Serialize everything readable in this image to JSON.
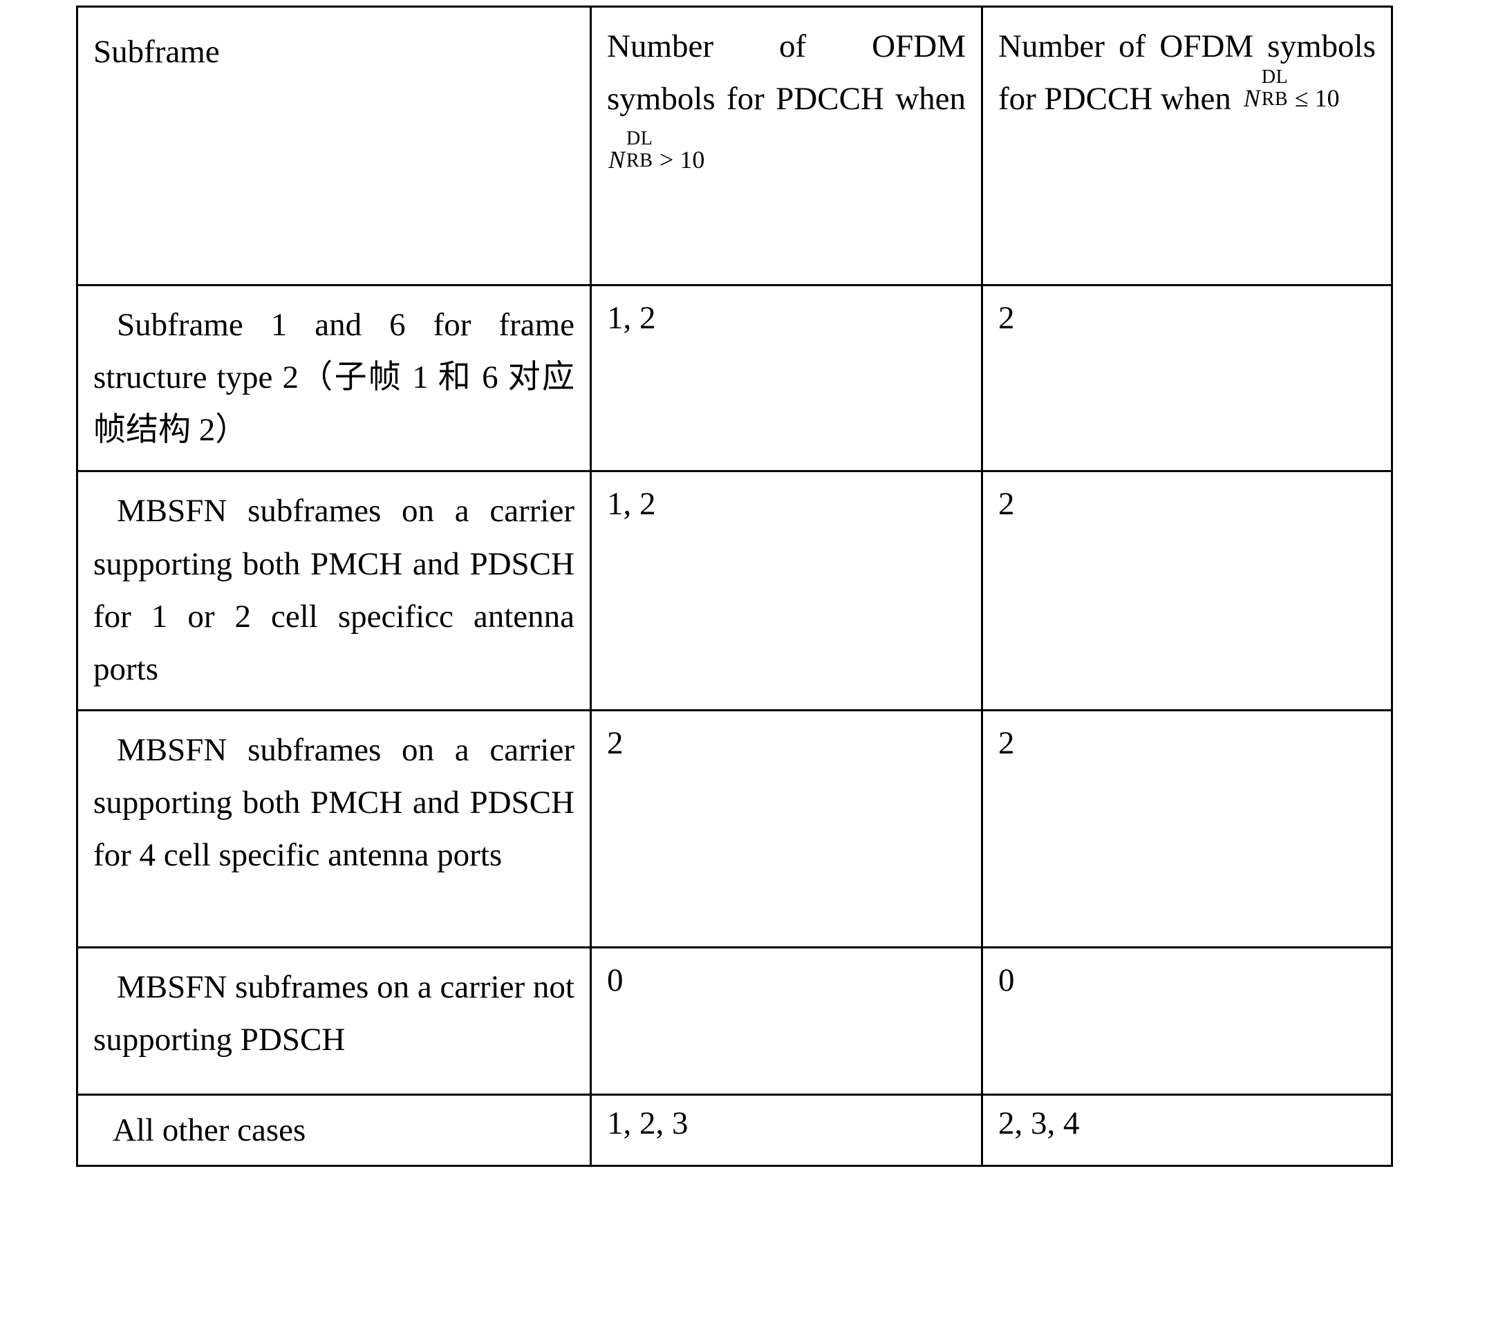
{
  "table": {
    "caption_visible": false,
    "columns": [
      {
        "key": "subframe",
        "header": "Subframe"
      },
      {
        "key": "gt10",
        "header_prefix": "Number of OFDM symbols for PDCCH when",
        "math": {
          "var": "N",
          "sup": "DL",
          "sub": "RB",
          "relation": "> 10"
        }
      },
      {
        "key": "le10",
        "header_prefix": "Number of OFDM symbols for PDCCH when",
        "math": {
          "var": "N",
          "sup": "DL",
          "sub": "RB",
          "relation": "≤ 10"
        }
      }
    ],
    "rows": [
      {
        "subframe": "Subframe 1 and 6 for frame structure type 2（子帧 1 和 6 对应帧结构 2）",
        "gt10": "1, 2",
        "le10": "2"
      },
      {
        "subframe": "MBSFN subframes on a carrier supporting both PMCH and PDSCH for 1 or 2 cell specificc antenna ports",
        "gt10": "1, 2",
        "le10": "2"
      },
      {
        "subframe": "MBSFN subframes on a carrier supporting both PMCH and PDSCH for 4 cell specific antenna ports",
        "gt10": "2",
        "le10": "2"
      },
      {
        "subframe": "MBSFN subframes on a carrier not supporting PDSCH",
        "gt10": "0",
        "le10": "0"
      },
      {
        "subframe": "All other cases",
        "gt10": "1, 2, 3",
        "le10": "2, 3, 4"
      }
    ]
  },
  "style": {
    "border_color": "#000000",
    "text_color": "#000000",
    "background": "#ffffff"
  }
}
